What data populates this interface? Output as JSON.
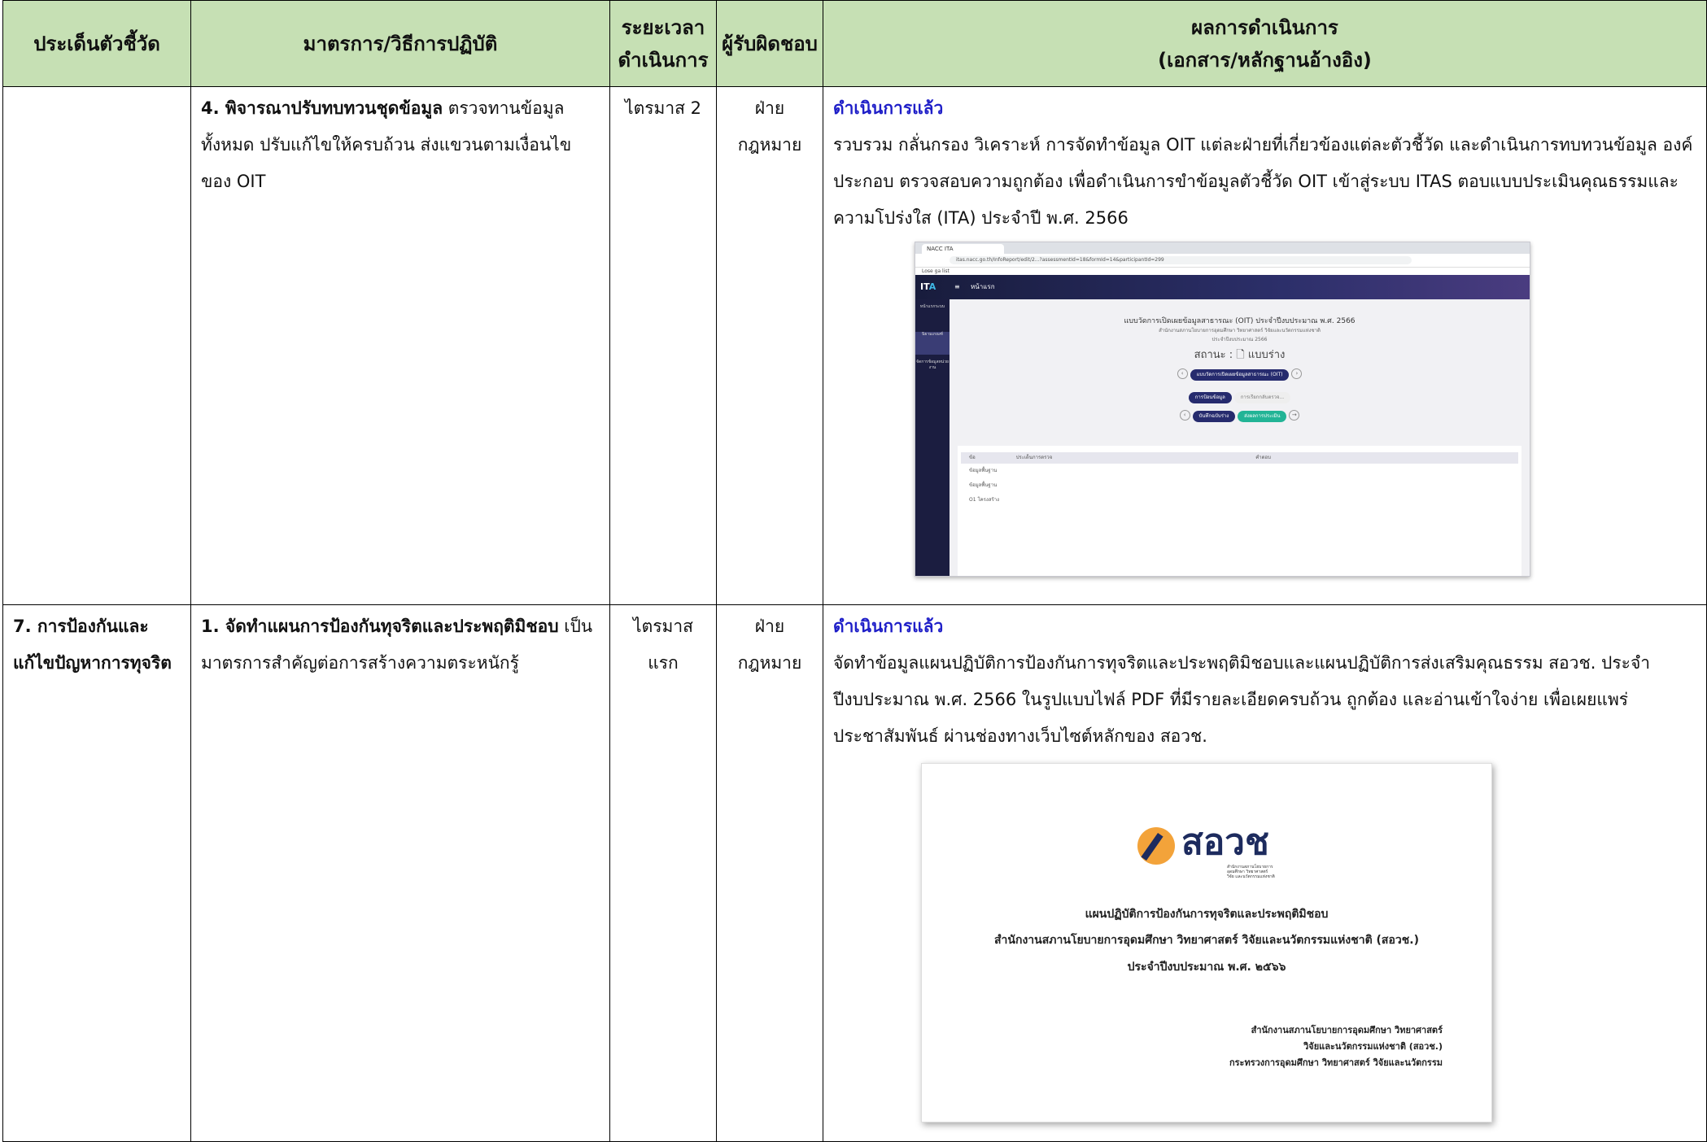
{
  "headers": {
    "col1": "ประเด็นตัวชี้วัด",
    "col2": "มาตรการ/วิธีการปฏิบัติ",
    "col3_line1": "ระยะเวลา",
    "col3_line2": "ดำเนินการ",
    "col4": "ผู้รับผิดชอบ",
    "col5_line1": "ผลการดำเนินการ",
    "col5_line2": "(เอกสาร/หลักฐานอ้างอิง)"
  },
  "row1": {
    "indicator": "",
    "measure_bold": "4. พิจารณาปรับทบทวนชุดข้อมูล",
    "measure_text": " ตรวจทานข้อมูลทั้งหมด ปรับแก้ไขให้ครบถ้วน ส่งแขวนตามเงื่อนไขของ OIT",
    "period": "ไตรมาส 2",
    "owner": "ฝ่ายกฎหมาย",
    "status": "ดำเนินการแล้ว",
    "result": "รวบรวม กลั่นกรอง วิเคราะห์ การจัดทำข้อมูล OIT แต่ละฝ่ายที่เกี่ยวข้องแต่ละตัวชี้วัด และดำเนินการทบทวนข้อมูล องค์ประกอบ ตรวจสอบความถูกต้อง เพื่อดำเนินการขำข้อมูลตัวชี้วัด OIT เข้าสู่ระบบ ITAS ตอบแบบประเมินคุณธรรมและความโปร่งใส (ITA) ประจำปี พ.ศ. 2566"
  },
  "screenshot": {
    "tab": "NACC ITA",
    "url": "itas.nacc.go.th/InfoReport/edit/2...?assessmentId=18&formId=14&participantId=299",
    "bookmark": "Lose ga list",
    "logo_a": "IT",
    "logo_b": "A",
    "menu": "หน้าแรก",
    "side1": "หน้าแรกระบบ",
    "side2": "นิยามเกณฑ์",
    "side3": "จัดการข้อมูลหน่วยงาน",
    "title": "แบบวัดการเปิดเผยข้อมูลสาธารณะ (OIT) ประจำปีงบประมาณ พ.ศ. 2566",
    "agency": "สำนักงานสภานโยบายการอุดมศึกษา วิทยาศาสตร์ วิจัยและนวัตกรรมแห่งชาติ",
    "fy": "ประจำปีงบประมาณ 2566",
    "state": "สถานะ : 🗋 แบบร่าง",
    "pill_main": "แบบวัดการเปิดเผยข้อมูลสาธารณะ (OIT)",
    "step1": "การป้อนข้อมูล",
    "step2": "การเรียกกลับตรวจ...",
    "btn_save": "บันทึกฉบับร่าง",
    "btn_send": "ส่งผลการประเมิน",
    "tbl_h1": "ข้อ",
    "tbl_h2": "ประเด็นการตรวจ",
    "tbl_h3": "คำตอบ",
    "tbl_r1": "ข้อมูลพื้นฐาน",
    "tbl_r2": "ข้อมูลพื้นฐาน",
    "tbl_r3": "O1   โครงสร้าง"
  },
  "row2": {
    "indicator": "7. การป้องกันและแก้ไขปัญหาการทุจริต",
    "measure_bold": "1. จัดทำแผนการป้องกันทุจริตและประพฤติมิชอบ",
    "measure_text": " เป็นมาตรการสำคัญต่อการสร้างความตระหนักรู้",
    "period": "ไตรมาสแรก",
    "owner": "ฝ่ายกฎหมาย",
    "status": "ดำเนินการแล้ว",
    "result": "จัดทำข้อมูลแผนปฏิบัติการป้องกันการทุจริตและประพฤติมิชอบและแผนปฏิบัติการส่งเสริมคุณธรรม สอวช. ประจำปีงบประมาณ พ.ศ. 2566 ในรูปแบบไฟล์ PDF ที่มีรายละเอียดครบถ้วน ถูกต้อง และอ่านเข้าใจง่าย เพื่อเผยแพร่ประชาสัมพันธ์ ผ่านช่องทางเว็บไซต์หลักของ สอวช."
  },
  "document": {
    "brand": "สอวช",
    "brand_sub": "สำนักงานสภานโยบายการอุดมศึกษา วิทยาศาสตร์ วิจัย และนวัตกรรมแห่งชาติ",
    "title1": "แผนปฏิบัติการป้องกันการทุจริตและประพฤติมิชอบ",
    "title2": "สำนักงานสภานโยบายการอุดมศึกษา วิทยาศาสตร์ วิจัยและนวัตกรรมแห่งชาติ (สอวช.)",
    "title3": "ประจำปีงบประมาณ พ.ศ. ๒๕๖๖",
    "org1": "สำนักงานสภานโยบายการอุดมศึกษา วิทยาศาสตร์",
    "org2": "วิจัยและนวัตกรรมแห่งชาติ (สอวช.)",
    "org3": "กระทรวงการอุดมศึกษา วิทยาศาสตร์ วิจัยและนวัตกรรม"
  }
}
